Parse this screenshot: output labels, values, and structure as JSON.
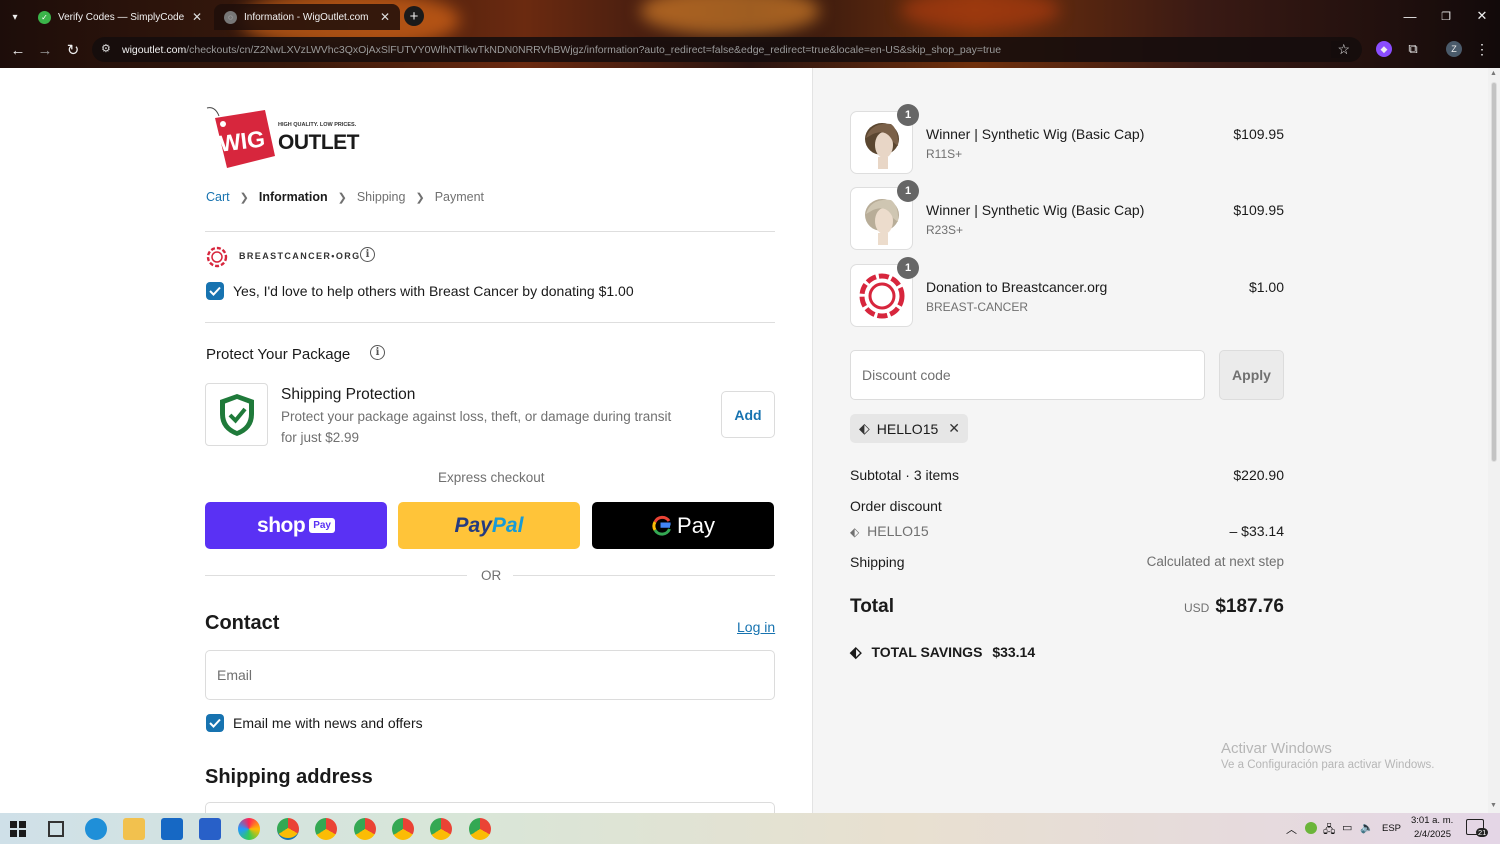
{
  "browser": {
    "tabs": [
      {
        "title": "Verify Codes — SimplyCodes",
        "active": false
      },
      {
        "title": "Information - WigOutlet.com",
        "active": true
      }
    ],
    "url_host": "wigoutlet.com",
    "url_path": "/checkouts/cn/Z2NwLXVzLWVhc3QxOjAxSlFUTVY0WlhNTlkwTkNDN0NRRVhBWjgz/information?auto_redirect=false&edge_redirect=true&locale=en-US&skip_shop_pay=true",
    "profile_initial": "Z"
  },
  "logo": {
    "brand_a": "WIG",
    "brand_b": "OUTLET",
    "tagline": "HIGH QUALITY. LOW PRICES."
  },
  "breadcrumb": {
    "cart": "Cart",
    "information": "Information",
    "shipping": "Shipping",
    "payment": "Payment"
  },
  "donation": {
    "org_label": "BREASTCANCER•ORG",
    "checkbox_label": "Yes, I'd love to help others with Breast Cancer by donating $1.00",
    "checked": true
  },
  "protection": {
    "heading": "Protect Your Package",
    "title": "Shipping Protection",
    "desc_line1": "Protect your package against loss, theft, or damage during transit",
    "desc_line2": "for just $2.99",
    "add_label": "Add"
  },
  "express": {
    "heading": "Express checkout",
    "shop_label": "shop",
    "shop_badge": "Pay",
    "paypal_a": "Pay",
    "paypal_b": "Pal",
    "gpay_label": "Pay",
    "or_label": "OR"
  },
  "contact": {
    "heading": "Contact",
    "login_label": "Log in",
    "email_placeholder": "Email",
    "news_label": "Email me with news and offers",
    "news_checked": true
  },
  "shipping_address": {
    "heading": "Shipping address"
  },
  "summary": {
    "items": [
      {
        "name": "Winner | Synthetic Wig (Basic Cap)",
        "variant": "R11S+",
        "price": "$109.95",
        "qty": "1"
      },
      {
        "name": "Winner | Synthetic Wig (Basic Cap)",
        "variant": "R23S+",
        "price": "$109.95",
        "qty": "1"
      },
      {
        "name": "Donation to Breastcancer.org",
        "variant": "BREAST-CANCER",
        "price": "$1.00",
        "qty": "1"
      }
    ],
    "discount_placeholder": "Discount code",
    "apply_label": "Apply",
    "applied_code": "HELLO15",
    "subtotal_label": "Subtotal · 3 items",
    "subtotal_value": "$220.90",
    "order_discount_label": "Order discount",
    "discount_code": "HELLO15",
    "discount_value": "– $33.14",
    "shipping_label": "Shipping",
    "shipping_value": "Calculated at next step",
    "total_label": "Total",
    "currency": "USD",
    "total_value": "$187.76",
    "savings_label": "TOTAL SAVINGS",
    "savings_value": "$33.14"
  },
  "watermark": {
    "line1": "Activar Windows",
    "line2": "Ve a Configuración para activar Windows."
  },
  "taskbar": {
    "lang": "ESP",
    "time": "3:01 a. m.",
    "date": "2/4/2025",
    "notif_count": "21"
  },
  "colors": {
    "accent": "#1773b0",
    "shop_pay": "#5a31f4",
    "paypal": "#ffc439",
    "gpay": "#000000",
    "ribbon": "#d7263d"
  }
}
